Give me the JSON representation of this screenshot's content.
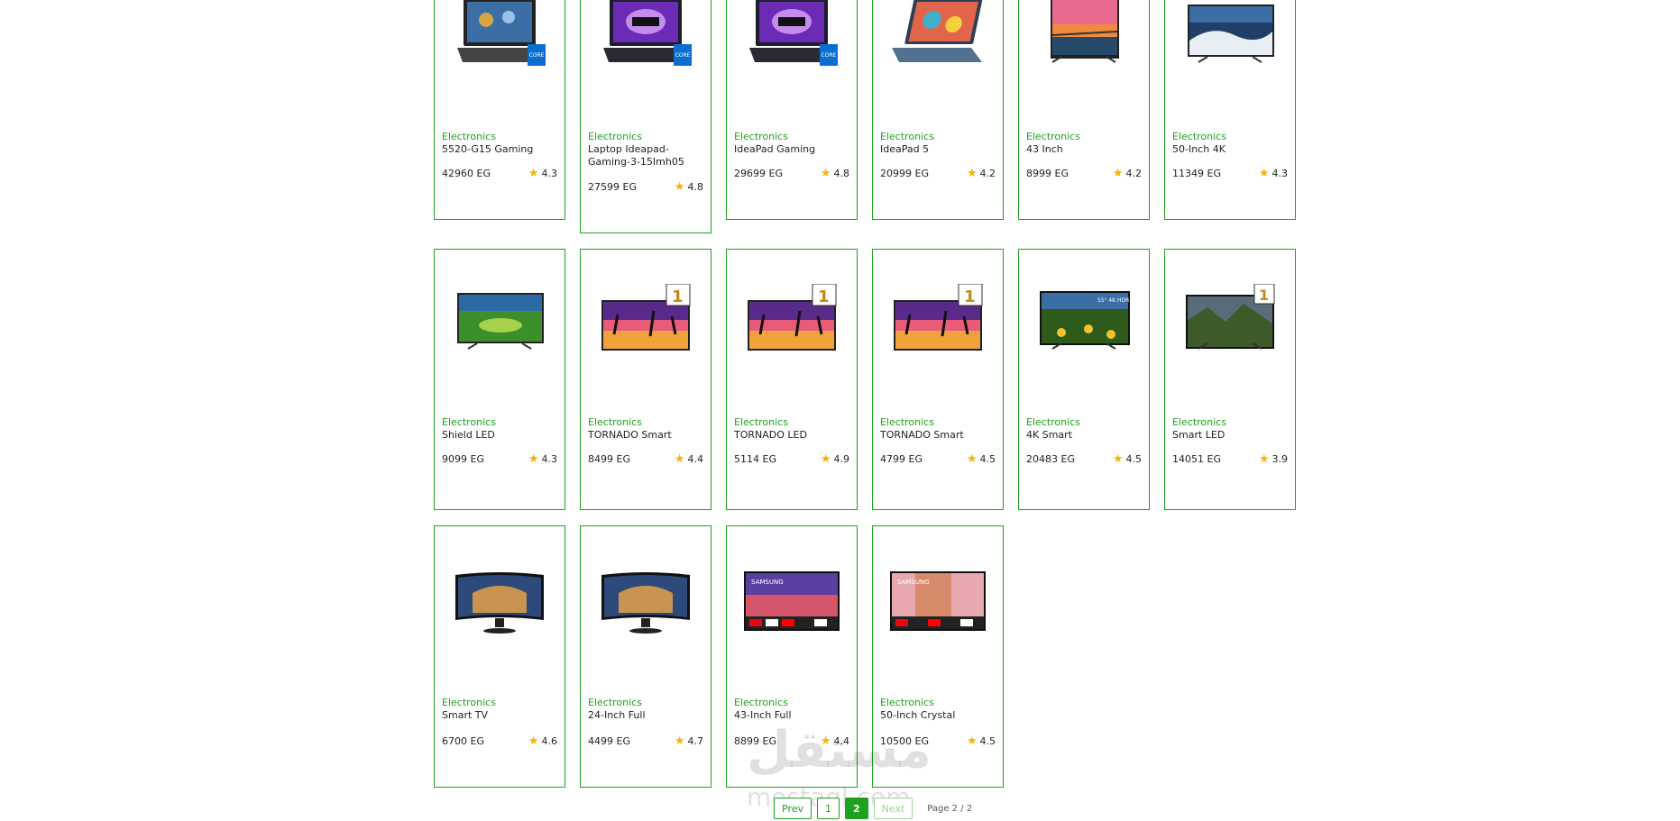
{
  "products": [
    {
      "category": "Electronics",
      "name": "5520-G15 Gaming",
      "price": "42960 EG",
      "rating": "4.3",
      "thumb": "laptop-gaming"
    },
    {
      "category": "Electronics",
      "name": "Laptop Ideapad-Gaming-3-15Imh05",
      "price": "27599 EG",
      "rating": "4.8",
      "thumb": "laptop-ideapad"
    },
    {
      "category": "Electronics",
      "name": "IdeaPad Gaming",
      "price": "29699 EG",
      "rating": "4.8",
      "thumb": "laptop-ideapad"
    },
    {
      "category": "Electronics",
      "name": "IdeaPad 5",
      "price": "20999 EG",
      "rating": "4.2",
      "thumb": "laptop-blue"
    },
    {
      "category": "Electronics",
      "name": "43 Inch",
      "price": "8999 EG",
      "rating": "4.2",
      "thumb": "tv-sunset"
    },
    {
      "category": "Electronics",
      "name": "50-Inch 4K",
      "price": "11349 EG",
      "rating": "4.3",
      "thumb": "tv-wave"
    },
    {
      "category": "Electronics",
      "name": "Shield LED",
      "price": "9099 EG",
      "rating": "4.3",
      "thumb": "tv-green"
    },
    {
      "category": "Electronics",
      "name": "TORNADO Smart",
      "price": "8499 EG",
      "rating": "4.4",
      "thumb": "tv-palms"
    },
    {
      "category": "Electronics",
      "name": "TORNADO LED",
      "price": "5114 EG",
      "rating": "4.9",
      "thumb": "tv-palms"
    },
    {
      "category": "Electronics",
      "name": "TORNADO Smart",
      "price": "4799 EG",
      "rating": "4.5",
      "thumb": "tv-palms"
    },
    {
      "category": "Electronics",
      "name": "4K Smart",
      "price": "20483 EG",
      "rating": "4.5",
      "thumb": "tv-flowers"
    },
    {
      "category": "Electronics",
      "name": "Smart LED",
      "price": "14051 EG",
      "rating": "3.9",
      "thumb": "tv-valley"
    },
    {
      "category": "Electronics",
      "name": "Smart TV",
      "price": "6700 EG",
      "rating": "4.6",
      "thumb": "monitor-arch"
    },
    {
      "category": "Electronics",
      "name": "24-Inch Full",
      "price": "4499 EG",
      "rating": "4.7",
      "thumb": "monitor-arch"
    },
    {
      "category": "Electronics",
      "name": "43-Inch Full",
      "price": "8899 EG",
      "rating": "4.4",
      "thumb": "tv-samsung"
    },
    {
      "category": "Electronics",
      "name": "50-Inch Crystal",
      "price": "10500 EG",
      "rating": "4.5",
      "thumb": "tv-samsung2"
    }
  ],
  "pagination": {
    "prev_label": "Prev",
    "pages": [
      "1",
      "2"
    ],
    "current": "2",
    "next_label": "Next",
    "info": "Page 2 / 2"
  },
  "watermark": {
    "arabic": "مستقل",
    "latin": "mostaql.com"
  },
  "colors": {
    "accent": "#1ea11e",
    "star": "#f5b301"
  }
}
